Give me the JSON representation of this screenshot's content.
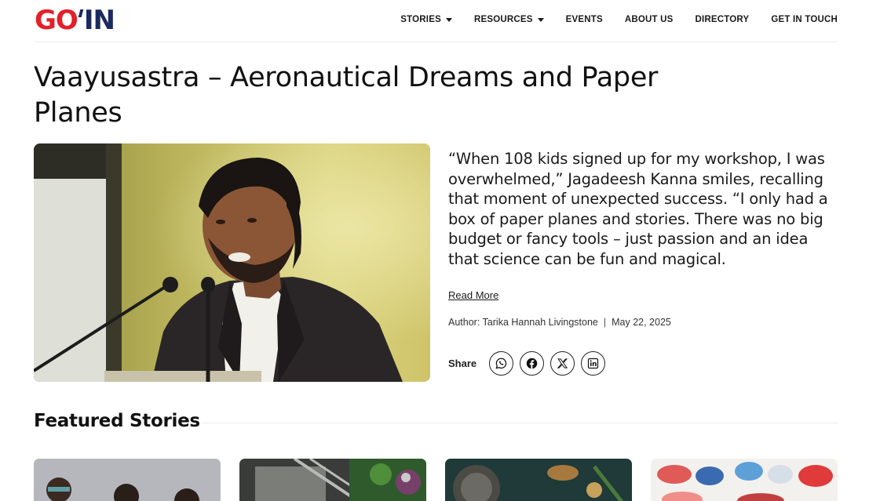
{
  "header": {
    "logo_go": "GO",
    "logo_in": "IN",
    "nav": [
      {
        "label": "STORIES",
        "has_dropdown": true
      },
      {
        "label": "RESOURCES",
        "has_dropdown": true
      },
      {
        "label": "EVENTS",
        "has_dropdown": false
      },
      {
        "label": "ABOUT US",
        "has_dropdown": false
      },
      {
        "label": "DIRECTORY",
        "has_dropdown": false
      },
      {
        "label": "GET IN TOUCH",
        "has_dropdown": false
      }
    ]
  },
  "article": {
    "title": "Vaayusastra – Aeronautical Dreams and Paper Planes",
    "quote": "“When 108 kids signed up for my workshop, I was overwhelmed,” Jagadeesh Kanna smiles, recalling that moment of unexpected success. “I only had a box of paper planes and stories. There was no big budget or fancy tools – just passion and an idea that science can be fun and magical.",
    "read_more": "Read More",
    "author": "Author: Tarika Hannah Livingstone",
    "separator": "|",
    "date": "May 22, 2025",
    "share_label": "Share",
    "share_icons": [
      "whatsapp-icon",
      "facebook-icon",
      "x-icon",
      "linkedin-icon"
    ]
  },
  "featured": {
    "title": "Featured Stories"
  },
  "colors": {
    "brand_red": "#e3202a",
    "brand_navy": "#1b2a5e"
  }
}
